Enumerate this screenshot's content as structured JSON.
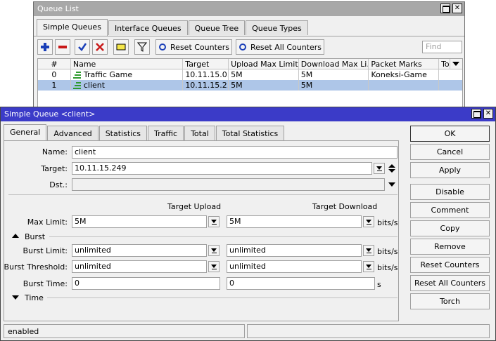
{
  "queue_list": {
    "title": "Queue List",
    "tabs": [
      "Simple Queues",
      "Interface Queues",
      "Queue Tree",
      "Queue Types"
    ],
    "toolbar": {
      "reset_counters": "Reset Counters",
      "reset_all_counters": "Reset All Counters",
      "find_placeholder": "Find"
    },
    "columns": [
      "#",
      "Name",
      "Target",
      "Upload Max Limit",
      "Download Max Li...",
      "Packet Marks",
      "To"
    ],
    "rows": [
      {
        "num": "0",
        "name": "Traffic Game",
        "target": "10.11.15.0...",
        "upload": "5M",
        "download": "5M",
        "marks": "Koneksi-Game",
        "to": ""
      },
      {
        "num": "1",
        "name": "client",
        "target": "10.11.15.2...",
        "upload": "5M",
        "download": "5M",
        "marks": "",
        "to": ""
      }
    ]
  },
  "simple_queue": {
    "title": "Simple Queue <client>",
    "tabs": [
      "General",
      "Advanced",
      "Statistics",
      "Traffic",
      "Total",
      "Total Statistics"
    ],
    "labels": {
      "name": "Name:",
      "target": "Target:",
      "dst": "Dst.:",
      "target_upload": "Target Upload",
      "target_download": "Target Download",
      "max_limit": "Max Limit:",
      "burst_section": "Burst",
      "burst_limit": "Burst Limit:",
      "burst_threshold": "Burst Threshold:",
      "burst_time": "Burst Time:",
      "time_section": "Time",
      "unit_bits": "bits/s",
      "unit_s": "s"
    },
    "values": {
      "name": "client",
      "target": "10.11.15.249",
      "dst": "",
      "max_up": "5M",
      "max_down": "5M",
      "burst_limit_up": "unlimited",
      "burst_limit_down": "unlimited",
      "burst_thr_up": "unlimited",
      "burst_thr_down": "unlimited",
      "burst_time_up": "0",
      "burst_time_down": "0"
    },
    "buttons": [
      "OK",
      "Cancel",
      "Apply",
      "Disable",
      "Comment",
      "Copy",
      "Remove",
      "Reset Counters",
      "Reset All Counters",
      "Torch"
    ],
    "status": "enabled"
  },
  "colors": {
    "title_active": "#3b3bc8",
    "title_inactive": "#a8a8a8",
    "selected_row": "#aec6e8"
  }
}
